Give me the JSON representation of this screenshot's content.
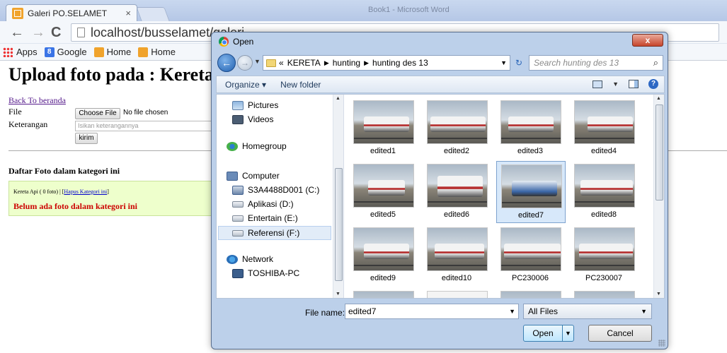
{
  "browser": {
    "tab_title": "Galeri PO.SELAMET",
    "tab_close": "×",
    "faded_title": "Book1 - Microsoft Word",
    "url": "localhost/busselamet/galeri",
    "bookmarks": [
      {
        "label": "Apps",
        "icon": "apps-icon"
      },
      {
        "label": "Google",
        "icon": "google-icon"
      },
      {
        "label": "Home",
        "icon": "home-icon"
      },
      {
        "label": "Home",
        "icon": "home-icon"
      }
    ]
  },
  "page": {
    "heading": "Upload foto pada : Kereta Ap",
    "back_link": "Back To beranda",
    "file_label": "File",
    "choose_file_label": "Choose File",
    "no_file_text": "No file chosen",
    "keterangan_label": "Keterangan",
    "keterangan_placeholder": "Isikan keterangannya",
    "submit_label": "kirim",
    "list_heading": "Daftar Foto dalam kategori ini",
    "category_prefix": "Kereta Api ( 0 foto) | [",
    "delete_category_link": "Hapus Kategori ini",
    "category_suffix": "]",
    "empty_message": "Belum ada foto dalam kategori ini"
  },
  "dialog": {
    "title": "Open",
    "close_label": "x",
    "breadcrumb": [
      "«",
      "KERETA",
      "hunting",
      "hunting des 13"
    ],
    "search_placeholder": "Search hunting des 13",
    "organize_label": "Organize ▾",
    "new_folder_label": "New folder",
    "nav_items": [
      {
        "label": "Pictures",
        "icon": "pictures-icon"
      },
      {
        "label": "Videos",
        "icon": "videos-icon"
      },
      {
        "label": "Homegroup",
        "icon": "homegroup-icon"
      },
      {
        "label": "Computer",
        "icon": "computer-icon"
      },
      {
        "label": "S3A4488D001 (C:)",
        "icon": "drive-icon"
      },
      {
        "label": "Aplikasi (D:)",
        "icon": "drive-icon"
      },
      {
        "label": "Entertain (E:)",
        "icon": "drive-icon"
      },
      {
        "label": "Referensi (F:)",
        "icon": "drive-icon"
      },
      {
        "label": "Network",
        "icon": "network-icon"
      },
      {
        "label": "TOSHIBA-PC",
        "icon": "pc-icon"
      }
    ],
    "files": [
      "edited1",
      "edited2",
      "edited3",
      "edited4",
      "edited5",
      "edited6",
      "edited7",
      "edited8",
      "edited9",
      "edited10",
      "PC230006",
      "PC230007"
    ],
    "selected_file": "edited7",
    "file_name_label": "File name:",
    "file_name_value": "edited7",
    "filter_value": "All Files",
    "open_label": "Open",
    "cancel_label": "Cancel"
  }
}
